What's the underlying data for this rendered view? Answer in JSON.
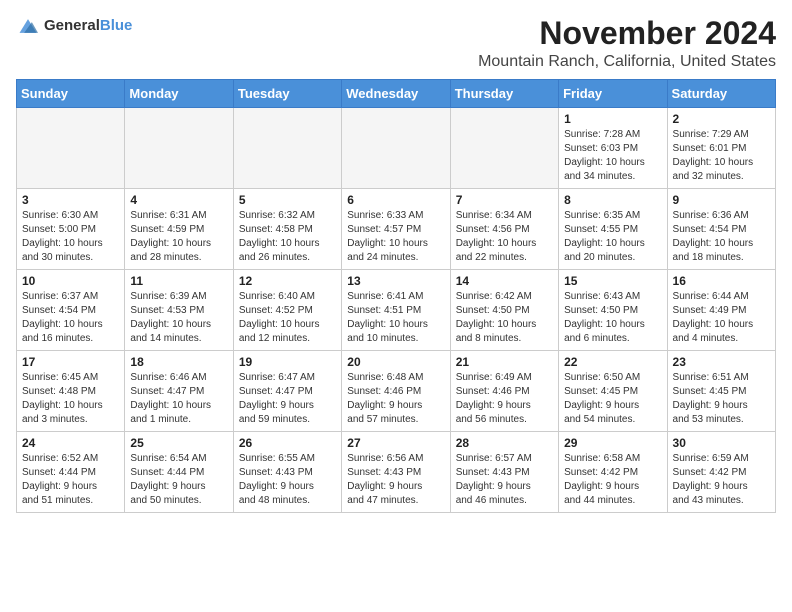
{
  "header": {
    "logo_general": "General",
    "logo_blue": "Blue",
    "month_title": "November 2024",
    "location": "Mountain Ranch, California, United States"
  },
  "days_of_week": [
    "Sunday",
    "Monday",
    "Tuesday",
    "Wednesday",
    "Thursday",
    "Friday",
    "Saturday"
  ],
  "weeks": [
    [
      {
        "day": "",
        "info": ""
      },
      {
        "day": "",
        "info": ""
      },
      {
        "day": "",
        "info": ""
      },
      {
        "day": "",
        "info": ""
      },
      {
        "day": "",
        "info": ""
      },
      {
        "day": "1",
        "info": "Sunrise: 7:28 AM\nSunset: 6:03 PM\nDaylight: 10 hours\nand 34 minutes."
      },
      {
        "day": "2",
        "info": "Sunrise: 7:29 AM\nSunset: 6:01 PM\nDaylight: 10 hours\nand 32 minutes."
      }
    ],
    [
      {
        "day": "3",
        "info": "Sunrise: 6:30 AM\nSunset: 5:00 PM\nDaylight: 10 hours\nand 30 minutes."
      },
      {
        "day": "4",
        "info": "Sunrise: 6:31 AM\nSunset: 4:59 PM\nDaylight: 10 hours\nand 28 minutes."
      },
      {
        "day": "5",
        "info": "Sunrise: 6:32 AM\nSunset: 4:58 PM\nDaylight: 10 hours\nand 26 minutes."
      },
      {
        "day": "6",
        "info": "Sunrise: 6:33 AM\nSunset: 4:57 PM\nDaylight: 10 hours\nand 24 minutes."
      },
      {
        "day": "7",
        "info": "Sunrise: 6:34 AM\nSunset: 4:56 PM\nDaylight: 10 hours\nand 22 minutes."
      },
      {
        "day": "8",
        "info": "Sunrise: 6:35 AM\nSunset: 4:55 PM\nDaylight: 10 hours\nand 20 minutes."
      },
      {
        "day": "9",
        "info": "Sunrise: 6:36 AM\nSunset: 4:54 PM\nDaylight: 10 hours\nand 18 minutes."
      }
    ],
    [
      {
        "day": "10",
        "info": "Sunrise: 6:37 AM\nSunset: 4:54 PM\nDaylight: 10 hours\nand 16 minutes."
      },
      {
        "day": "11",
        "info": "Sunrise: 6:39 AM\nSunset: 4:53 PM\nDaylight: 10 hours\nand 14 minutes."
      },
      {
        "day": "12",
        "info": "Sunrise: 6:40 AM\nSunset: 4:52 PM\nDaylight: 10 hours\nand 12 minutes."
      },
      {
        "day": "13",
        "info": "Sunrise: 6:41 AM\nSunset: 4:51 PM\nDaylight: 10 hours\nand 10 minutes."
      },
      {
        "day": "14",
        "info": "Sunrise: 6:42 AM\nSunset: 4:50 PM\nDaylight: 10 hours\nand 8 minutes."
      },
      {
        "day": "15",
        "info": "Sunrise: 6:43 AM\nSunset: 4:50 PM\nDaylight: 10 hours\nand 6 minutes."
      },
      {
        "day": "16",
        "info": "Sunrise: 6:44 AM\nSunset: 4:49 PM\nDaylight: 10 hours\nand 4 minutes."
      }
    ],
    [
      {
        "day": "17",
        "info": "Sunrise: 6:45 AM\nSunset: 4:48 PM\nDaylight: 10 hours\nand 3 minutes."
      },
      {
        "day": "18",
        "info": "Sunrise: 6:46 AM\nSunset: 4:47 PM\nDaylight: 10 hours\nand 1 minute."
      },
      {
        "day": "19",
        "info": "Sunrise: 6:47 AM\nSunset: 4:47 PM\nDaylight: 9 hours\nand 59 minutes."
      },
      {
        "day": "20",
        "info": "Sunrise: 6:48 AM\nSunset: 4:46 PM\nDaylight: 9 hours\nand 57 minutes."
      },
      {
        "day": "21",
        "info": "Sunrise: 6:49 AM\nSunset: 4:46 PM\nDaylight: 9 hours\nand 56 minutes."
      },
      {
        "day": "22",
        "info": "Sunrise: 6:50 AM\nSunset: 4:45 PM\nDaylight: 9 hours\nand 54 minutes."
      },
      {
        "day": "23",
        "info": "Sunrise: 6:51 AM\nSunset: 4:45 PM\nDaylight: 9 hours\nand 53 minutes."
      }
    ],
    [
      {
        "day": "24",
        "info": "Sunrise: 6:52 AM\nSunset: 4:44 PM\nDaylight: 9 hours\nand 51 minutes."
      },
      {
        "day": "25",
        "info": "Sunrise: 6:54 AM\nSunset: 4:44 PM\nDaylight: 9 hours\nand 50 minutes."
      },
      {
        "day": "26",
        "info": "Sunrise: 6:55 AM\nSunset: 4:43 PM\nDaylight: 9 hours\nand 48 minutes."
      },
      {
        "day": "27",
        "info": "Sunrise: 6:56 AM\nSunset: 4:43 PM\nDaylight: 9 hours\nand 47 minutes."
      },
      {
        "day": "28",
        "info": "Sunrise: 6:57 AM\nSunset: 4:43 PM\nDaylight: 9 hours\nand 46 minutes."
      },
      {
        "day": "29",
        "info": "Sunrise: 6:58 AM\nSunset: 4:42 PM\nDaylight: 9 hours\nand 44 minutes."
      },
      {
        "day": "30",
        "info": "Sunrise: 6:59 AM\nSunset: 4:42 PM\nDaylight: 9 hours\nand 43 minutes."
      }
    ]
  ]
}
